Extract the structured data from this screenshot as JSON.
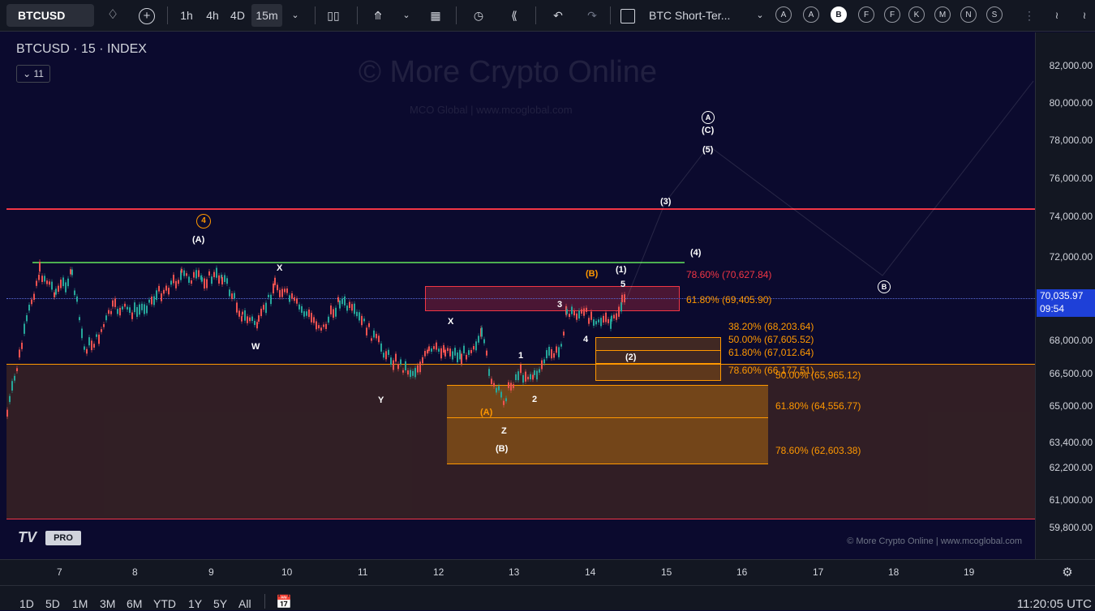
{
  "toolbar": {
    "symbol": "BTCUSD",
    "timeframes": [
      "1h",
      "4h",
      "4D",
      "15m"
    ],
    "active_timeframe": "15m",
    "layout_name": "BTC Short-Ter...",
    "circle_buttons": [
      "A",
      "A",
      "B",
      "F",
      "F",
      "K",
      "M",
      "N",
      "S"
    ],
    "active_circle": "B"
  },
  "chart": {
    "title": "BTCUSD · 15 · INDEX",
    "collapse_count": "11",
    "watermark": "© More Crypto Online",
    "watermark_sub": "MCO Global  |  www.mcoglobal.com",
    "logo": "PRO",
    "copyright": "© More Crypto Online  |  www.mcoglobal.com"
  },
  "price_axis": {
    "labels": [
      "82,000.00",
      "80,000.00",
      "78,000.00",
      "76,000.00",
      "74,000.00",
      "72,000.00",
      "68,000.00",
      "66,500.00",
      "65,000.00",
      "63,400.00",
      "62,200.00",
      "61,000.00",
      "59,800.00"
    ],
    "current_price": "70,035.97",
    "countdown": "09:54"
  },
  "time_axis": {
    "labels": [
      "7",
      "8",
      "9",
      "10",
      "11",
      "12",
      "13",
      "14",
      "15",
      "16",
      "17",
      "18",
      "19"
    ]
  },
  "wave_labels": {
    "circled_4": "4",
    "A_paren": "(A)",
    "X1": "X",
    "W": "W",
    "X2": "X",
    "Y": "Y",
    "Z": "Z",
    "A_orange": "(A)",
    "B_white": "(B)",
    "one": "1",
    "two": "2",
    "three": "3",
    "four": "4",
    "five": "5",
    "p1": "(1)",
    "p2": "(2)",
    "p3": "(3)",
    "p4": "(4)",
    "p5": "(5)",
    "pC": "(C)",
    "circled_A": "A",
    "circled_B": "B",
    "B_orange": "(B)"
  },
  "fib_labels": {
    "f7860_top": "78.60% (70,627.84)",
    "f6180_top": "61.80% (69,405.90)",
    "f3820": "38.20% (68,203.64)",
    "f5000_mid": "50.00% (67,605.52)",
    "f6180_mid": "61.80% (67,012.64)",
    "f7860_mid": "78.60% (66,177.51)",
    "f5000_low": "50.00% (65,965.12)",
    "f6180_low": "61.80% (64,556.77)",
    "f7860_low": "78.60% (62,603.38)"
  },
  "bottom_bar": {
    "ranges": [
      "1D",
      "5D",
      "1M",
      "3M",
      "6M",
      "YTD",
      "1Y",
      "5Y",
      "All"
    ],
    "clock": "11:20:05 UTC"
  },
  "colors": {
    "background": "#0b0a2e",
    "resistance": "#f23645",
    "support_line": "#4caf50",
    "fib_orange": "#ff9800",
    "price_tag": "#1e40d8"
  }
}
